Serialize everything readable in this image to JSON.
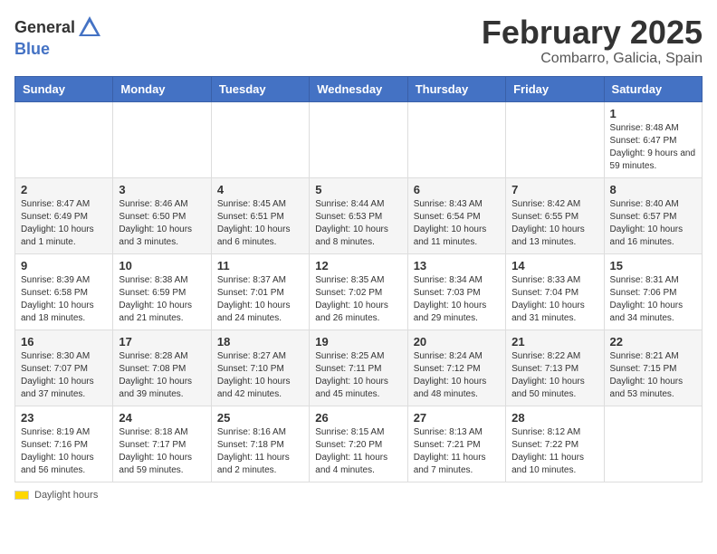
{
  "header": {
    "logo_general": "General",
    "logo_blue": "Blue",
    "month_year": "February 2025",
    "location": "Combarro, Galicia, Spain"
  },
  "calendar": {
    "days_of_week": [
      "Sunday",
      "Monday",
      "Tuesday",
      "Wednesday",
      "Thursday",
      "Friday",
      "Saturday"
    ],
    "weeks": [
      [
        {
          "day": "",
          "info": ""
        },
        {
          "day": "",
          "info": ""
        },
        {
          "day": "",
          "info": ""
        },
        {
          "day": "",
          "info": ""
        },
        {
          "day": "",
          "info": ""
        },
        {
          "day": "",
          "info": ""
        },
        {
          "day": "1",
          "info": "Sunrise: 8:48 AM\nSunset: 6:47 PM\nDaylight: 9 hours and 59 minutes."
        }
      ],
      [
        {
          "day": "2",
          "info": "Sunrise: 8:47 AM\nSunset: 6:49 PM\nDaylight: 10 hours and 1 minute."
        },
        {
          "day": "3",
          "info": "Sunrise: 8:46 AM\nSunset: 6:50 PM\nDaylight: 10 hours and 3 minutes."
        },
        {
          "day": "4",
          "info": "Sunrise: 8:45 AM\nSunset: 6:51 PM\nDaylight: 10 hours and 6 minutes."
        },
        {
          "day": "5",
          "info": "Sunrise: 8:44 AM\nSunset: 6:53 PM\nDaylight: 10 hours and 8 minutes."
        },
        {
          "day": "6",
          "info": "Sunrise: 8:43 AM\nSunset: 6:54 PM\nDaylight: 10 hours and 11 minutes."
        },
        {
          "day": "7",
          "info": "Sunrise: 8:42 AM\nSunset: 6:55 PM\nDaylight: 10 hours and 13 minutes."
        },
        {
          "day": "8",
          "info": "Sunrise: 8:40 AM\nSunset: 6:57 PM\nDaylight: 10 hours and 16 minutes."
        }
      ],
      [
        {
          "day": "9",
          "info": "Sunrise: 8:39 AM\nSunset: 6:58 PM\nDaylight: 10 hours and 18 minutes."
        },
        {
          "day": "10",
          "info": "Sunrise: 8:38 AM\nSunset: 6:59 PM\nDaylight: 10 hours and 21 minutes."
        },
        {
          "day": "11",
          "info": "Sunrise: 8:37 AM\nSunset: 7:01 PM\nDaylight: 10 hours and 24 minutes."
        },
        {
          "day": "12",
          "info": "Sunrise: 8:35 AM\nSunset: 7:02 PM\nDaylight: 10 hours and 26 minutes."
        },
        {
          "day": "13",
          "info": "Sunrise: 8:34 AM\nSunset: 7:03 PM\nDaylight: 10 hours and 29 minutes."
        },
        {
          "day": "14",
          "info": "Sunrise: 8:33 AM\nSunset: 7:04 PM\nDaylight: 10 hours and 31 minutes."
        },
        {
          "day": "15",
          "info": "Sunrise: 8:31 AM\nSunset: 7:06 PM\nDaylight: 10 hours and 34 minutes."
        }
      ],
      [
        {
          "day": "16",
          "info": "Sunrise: 8:30 AM\nSunset: 7:07 PM\nDaylight: 10 hours and 37 minutes."
        },
        {
          "day": "17",
          "info": "Sunrise: 8:28 AM\nSunset: 7:08 PM\nDaylight: 10 hours and 39 minutes."
        },
        {
          "day": "18",
          "info": "Sunrise: 8:27 AM\nSunset: 7:10 PM\nDaylight: 10 hours and 42 minutes."
        },
        {
          "day": "19",
          "info": "Sunrise: 8:25 AM\nSunset: 7:11 PM\nDaylight: 10 hours and 45 minutes."
        },
        {
          "day": "20",
          "info": "Sunrise: 8:24 AM\nSunset: 7:12 PM\nDaylight: 10 hours and 48 minutes."
        },
        {
          "day": "21",
          "info": "Sunrise: 8:22 AM\nSunset: 7:13 PM\nDaylight: 10 hours and 50 minutes."
        },
        {
          "day": "22",
          "info": "Sunrise: 8:21 AM\nSunset: 7:15 PM\nDaylight: 10 hours and 53 minutes."
        }
      ],
      [
        {
          "day": "23",
          "info": "Sunrise: 8:19 AM\nSunset: 7:16 PM\nDaylight: 10 hours and 56 minutes."
        },
        {
          "day": "24",
          "info": "Sunrise: 8:18 AM\nSunset: 7:17 PM\nDaylight: 10 hours and 59 minutes."
        },
        {
          "day": "25",
          "info": "Sunrise: 8:16 AM\nSunset: 7:18 PM\nDaylight: 11 hours and 2 minutes."
        },
        {
          "day": "26",
          "info": "Sunrise: 8:15 AM\nSunset: 7:20 PM\nDaylight: 11 hours and 4 minutes."
        },
        {
          "day": "27",
          "info": "Sunrise: 8:13 AM\nSunset: 7:21 PM\nDaylight: 11 hours and 7 minutes."
        },
        {
          "day": "28",
          "info": "Sunrise: 8:12 AM\nSunset: 7:22 PM\nDaylight: 11 hours and 10 minutes."
        },
        {
          "day": "",
          "info": ""
        }
      ]
    ]
  },
  "footer": {
    "daylight_label": "Daylight hours"
  }
}
